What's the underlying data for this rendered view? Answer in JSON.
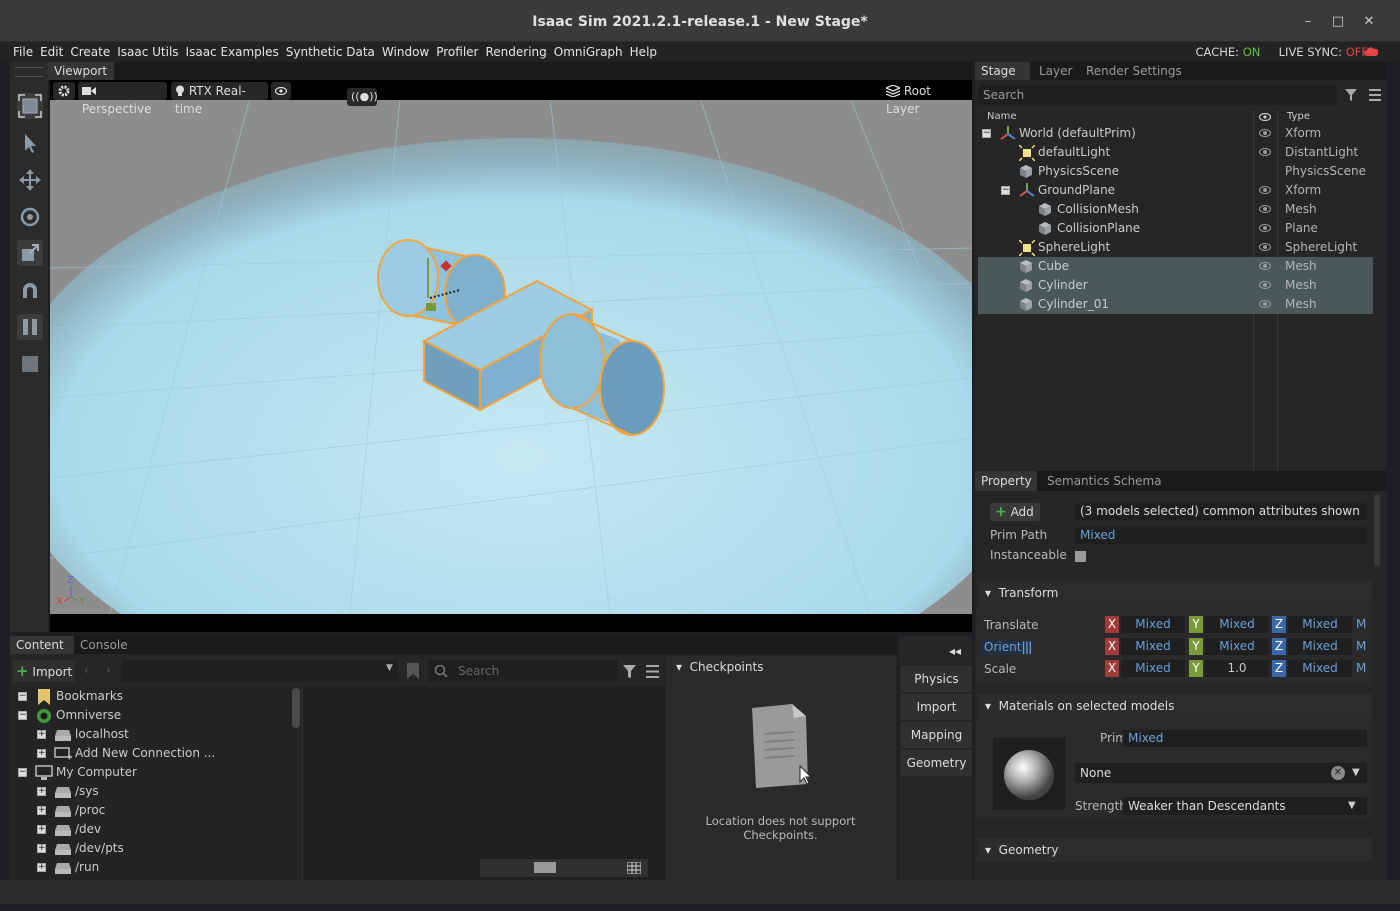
{
  "window": {
    "title": "Isaac Sim 2021.2.1-release.1 - New Stage*",
    "minimize": "–",
    "maximize": "□",
    "close": "✕"
  },
  "menu": [
    "File",
    "Edit",
    "Create",
    "Isaac Utils",
    "Isaac Examples",
    "Synthetic Data",
    "Window",
    "Profiler",
    "Rendering",
    "OmniGraph",
    "Help"
  ],
  "status": {
    "cache_label": "CACHE:",
    "cache_value": "ON",
    "livesync_label": "LIVE SYNC:",
    "livesync_value": "OFF"
  },
  "viewport": {
    "tab": "Viewport",
    "camera": "Perspective",
    "renderer": "RTX Real-time",
    "broadcast": "((●))",
    "layer": "Root Layer",
    "axes": {
      "z": "Z",
      "x": "X",
      "y": "Y"
    }
  },
  "stage": {
    "tabs": [
      "Stage",
      "Layer",
      "Render Settings"
    ],
    "search_placeholder": "Search",
    "col_name": "Name",
    "col_type": "Type",
    "rows": [
      {
        "name": "World (defaultPrim)",
        "type": "Xform",
        "eye": true,
        "indent": 0,
        "icon": "xform-icon",
        "expander": "−",
        "selected": false
      },
      {
        "name": "defaultLight",
        "type": "DistantLight",
        "eye": true,
        "indent": 1,
        "icon": "light-icon",
        "selected": false
      },
      {
        "name": "PhysicsScene",
        "type": "PhysicsScene",
        "eye": false,
        "indent": 1,
        "icon": "cube-icon",
        "selected": false
      },
      {
        "name": "GroundPlane",
        "type": "Xform",
        "eye": true,
        "indent": 1,
        "icon": "xform-icon",
        "expander": "−",
        "selected": false
      },
      {
        "name": "CollisionMesh",
        "type": "Mesh",
        "eye": true,
        "indent": 2,
        "icon": "cube-icon",
        "selected": false
      },
      {
        "name": "CollisionPlane",
        "type": "Plane",
        "eye": true,
        "indent": 2,
        "icon": "cube-icon",
        "selected": false
      },
      {
        "name": "SphereLight",
        "type": "SphereLight",
        "eye": true,
        "indent": 1,
        "icon": "light-icon",
        "selected": false
      },
      {
        "name": "Cube",
        "type": "Mesh",
        "eye": true,
        "indent": 1,
        "icon": "cube-icon",
        "selected": true
      },
      {
        "name": "Cylinder",
        "type": "Mesh",
        "eye": true,
        "indent": 1,
        "icon": "cube-icon",
        "selected": true
      },
      {
        "name": "Cylinder_01",
        "type": "Mesh",
        "eye": true,
        "indent": 1,
        "icon": "cube-icon",
        "selected": true
      }
    ]
  },
  "property": {
    "tabs": [
      "Property",
      "Semantics Schema Editor"
    ],
    "add": "Add",
    "summary": "(3 models selected) common attributes shown",
    "prim_path_label": "Prim Path",
    "prim_path_value": "Mixed",
    "instanceable_label": "Instanceable",
    "transform_header": "Transform",
    "translate_label": "Translate",
    "orient_label": "Orient",
    "scale_label": "Scale",
    "translate": {
      "x": "Mixed",
      "y": "Mixed",
      "z": "Mixed"
    },
    "orient": {
      "x": "Mixed",
      "y": "Mixed",
      "z": "Mixed"
    },
    "scale": {
      "x": "Mixed",
      "y": "1.0",
      "z": "Mixed"
    },
    "m": "M",
    "materials_header": "Materials on selected models",
    "prim_label": "Prim",
    "prim_value": "Mixed",
    "material_value": "None",
    "strength_label": "Strength",
    "strength_value": "Weaker than Descendants",
    "geometry_header": "Geometry"
  },
  "content": {
    "tabs": [
      "Content",
      "Console"
    ],
    "import": "Import",
    "search_placeholder": "Search",
    "tree": [
      {
        "label": "Bookmarks",
        "level": 0,
        "expander": "−",
        "icon": "bookmark-icon"
      },
      {
        "label": "Omniverse",
        "level": 0,
        "expander": "−",
        "icon": "omniverse-icon"
      },
      {
        "label": "localhost",
        "level": 1,
        "expander": "+",
        "icon": "drive-icon"
      },
      {
        "label": "Add New Connection ...",
        "level": 1,
        "expander": "+",
        "icon": "add-connection-icon"
      },
      {
        "label": "My Computer",
        "level": 0,
        "expander": "−",
        "icon": "computer-icon"
      },
      {
        "label": "/sys",
        "level": 1,
        "expander": "+",
        "icon": "drive-icon"
      },
      {
        "label": "/proc",
        "level": 1,
        "expander": "+",
        "icon": "drive-icon"
      },
      {
        "label": "/dev",
        "level": 1,
        "expander": "+",
        "icon": "drive-icon"
      },
      {
        "label": "/dev/pts",
        "level": 1,
        "expander": "+",
        "icon": "drive-icon"
      },
      {
        "label": "/run",
        "level": 1,
        "expander": "+",
        "icon": "drive-icon"
      }
    ],
    "checkpoints_header": "Checkpoints",
    "checkpoints_message_1": "Location does not support",
    "checkpoints_message_2": "Checkpoints."
  },
  "side_buttons": {
    "collapse": "◂◂",
    "items": [
      "Physics",
      "Import",
      "Mapping",
      "Geometry"
    ]
  }
}
